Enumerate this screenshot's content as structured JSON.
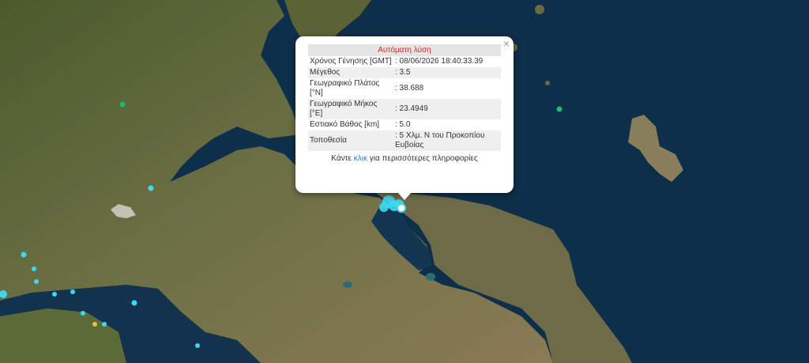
{
  "popup": {
    "title": "Αυτόματη λύση",
    "close": "×",
    "rows": [
      {
        "key": "Χρόνος Γένησης [GMT]",
        "value": ": 08/06/2026 18:40:33.39"
      },
      {
        "key": "Μέγεθος",
        "value": ": 3.5"
      },
      {
        "key": "Γεωγραφικό Πλάτος [°N]",
        "value": ": 38.688"
      },
      {
        "key": "Γεωγραφικό Μήκος [°E]",
        "value": ": 23.4949"
      },
      {
        "key": "Εστιακό Βάθος [km]",
        "value": ": 5.0"
      },
      {
        "key": "Τοποθεσία",
        "value": ": 5 Χλμ. N του Προκοπίου Ευβοίας"
      }
    ],
    "footer_pre": "Κάντε ",
    "footer_link": "κλικ",
    "footer_post": " για περισσότερες πληροφορίες"
  },
  "colors": {
    "sea": "#0e2f49",
    "land": "#5f6a3c",
    "marker_recent": "#3dd8f0",
    "marker_green": "#1fb870",
    "marker_yellow": "#e6c03a"
  }
}
